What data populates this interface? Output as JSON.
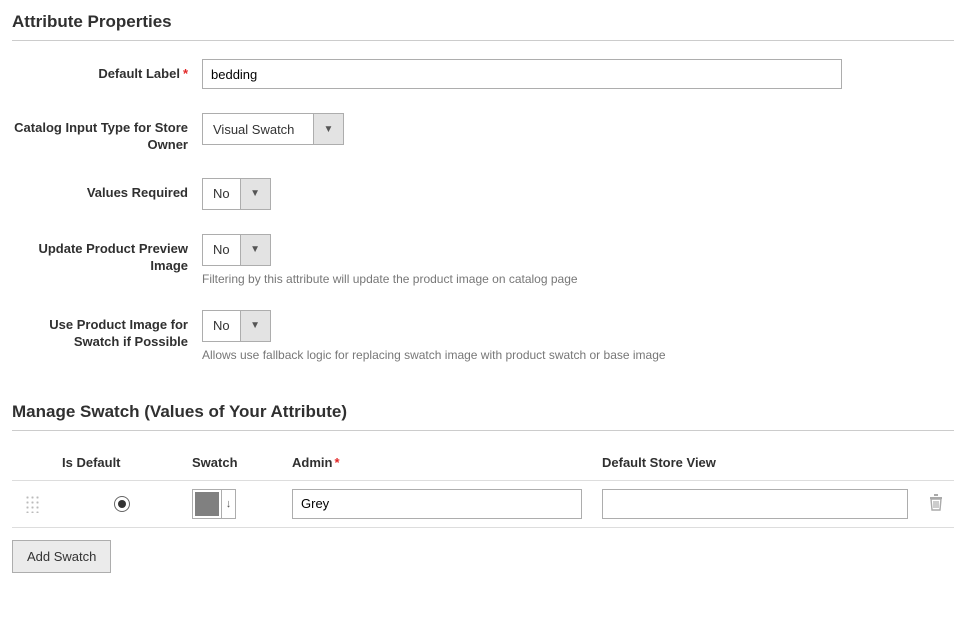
{
  "section1": {
    "title": "Attribute Properties",
    "fields": {
      "default_label": {
        "label": "Default Label",
        "required": true,
        "value": "bedding"
      },
      "input_type": {
        "label": "Catalog Input Type for Store Owner",
        "value": "Visual Swatch"
      },
      "values_required": {
        "label": "Values Required",
        "value": "No"
      },
      "update_preview": {
        "label": "Update Product Preview Image",
        "value": "No",
        "help": "Filtering by this attribute will update the product image on catalog page"
      },
      "use_product_img": {
        "label": "Use Product Image for Swatch if Possible",
        "value": "No",
        "help": "Allows use fallback logic for replacing swatch image with product swatch or base image"
      }
    }
  },
  "section2": {
    "title": "Manage Swatch (Values of Your Attribute)",
    "headers": {
      "is_default": "Is Default",
      "swatch": "Swatch",
      "admin": "Admin",
      "store_view": "Default Store View"
    },
    "rows": [
      {
        "is_default": true,
        "swatch_color": "#808080",
        "admin": "Grey",
        "store_view": ""
      }
    ],
    "add_label": "Add Swatch"
  }
}
